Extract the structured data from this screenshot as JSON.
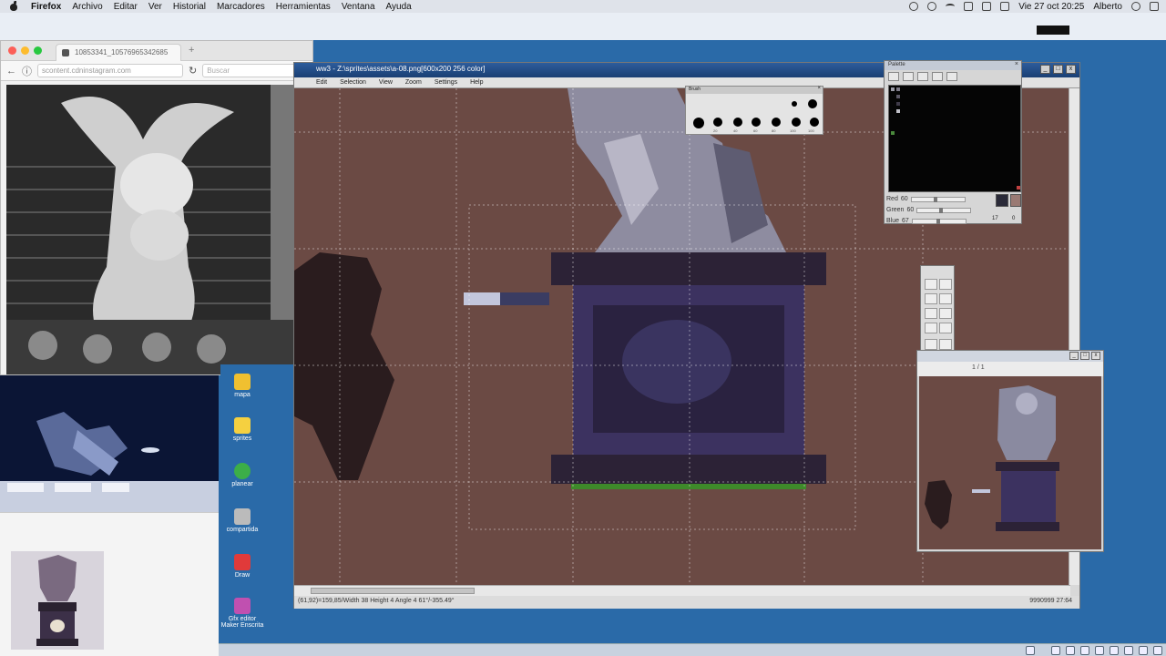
{
  "menubar": {
    "app": "Firefox",
    "items": [
      "Archivo",
      "Editar",
      "Ver",
      "Historial",
      "Marcadores",
      "Herramientas",
      "Ventana",
      "Ayuda"
    ],
    "datetime": "Vie 27 oct  20:25",
    "user": "Alberto"
  },
  "firefox": {
    "tab_title": "10853341_10576965342685",
    "new_tab": "+",
    "url": "scontent.cdninstagram.com",
    "search_placeholder": "Buscar"
  },
  "grafx2": {
    "title": "ww3 - Z:\\sprites\\assets\\a-08.png[600x200 256 color]",
    "menu": [
      "Edit",
      "Selection",
      "View",
      "Zoom",
      "Settings",
      "Help"
    ],
    "window_buttons": [
      "_",
      "□",
      "x"
    ],
    "status_left": "(61,92)=159,85/Width 38 Height 4 Angle 4 61°/-355.49°",
    "status_right": "9990999        27:64"
  },
  "palette": {
    "title": "Palette",
    "red_label": "Red",
    "red_value": "60",
    "green_label": "Green",
    "green_value": "60",
    "blue_label": "Blue",
    "blue_value": "67",
    "count_a": "17",
    "count_b": "0",
    "colors": [
      "#9a9aa6",
      "#7d7a88",
      "#5c5866",
      "#3e3a48",
      "#6b4a44",
      "#8a6a5c",
      "#4a8a3c",
      "#c0c0c8"
    ]
  },
  "brushes": {
    "title": "Brush",
    "labels": [
      "20",
      "40",
      "60",
      "80",
      "100",
      "100"
    ]
  },
  "preview": {
    "title": "1 / 1",
    "buttons": [
      "_",
      "□",
      "x"
    ]
  },
  "desktop_icons": [
    {
      "label": "mapa",
      "color": "#f0c030"
    },
    {
      "label": "sprites",
      "color": "#f5d040"
    },
    {
      "label": "planear",
      "color": "#3cae48"
    },
    {
      "label": "compartida",
      "color": "#bbbbbb"
    },
    {
      "label": "Draw",
      "color": "#e03a3a"
    },
    {
      "label": "Gfx editor Maker Enscrita",
      "color": "#c050b0"
    }
  ]
}
